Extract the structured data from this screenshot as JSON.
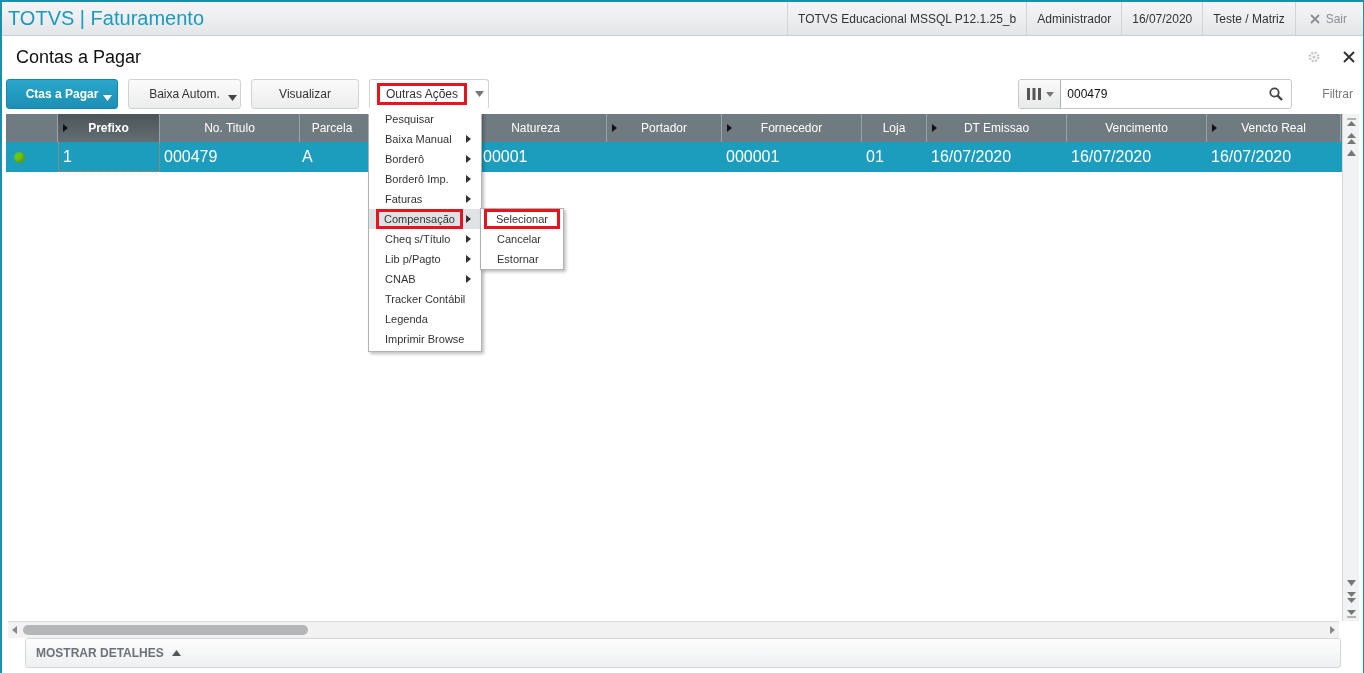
{
  "header": {
    "brand": "TOTVS | Faturamento",
    "items": [
      "TOTVS Educacional MSSQL P12.1.25_b",
      "Administrador",
      "16/07/2020",
      "Teste / Matriz"
    ],
    "exit": "Sair"
  },
  "page": {
    "title": "Contas a Pagar"
  },
  "toolbar": {
    "buttons": [
      {
        "label": "Ctas a Pagar",
        "kind": "primary",
        "dropdown": true,
        "highlighted": false
      },
      {
        "label": "Baixa Autom.",
        "kind": "plain",
        "dropdown": true,
        "highlighted": false
      },
      {
        "label": "Visualizar",
        "kind": "plain",
        "dropdown": false,
        "highlighted": false
      },
      {
        "label": "Outras Ações",
        "kind": "menu",
        "dropdown": true,
        "highlighted": true
      }
    ]
  },
  "search": {
    "value": "000479",
    "filter": "Filtrar"
  },
  "table": {
    "columns": [
      {
        "label": "Prefixo",
        "marker": true,
        "selected": true
      },
      {
        "label": "No. Titulo",
        "marker": false,
        "selected": false
      },
      {
        "label": "Parcela",
        "marker": false,
        "selected": false
      },
      {
        "label": "Natureza",
        "selected": false
      },
      {
        "label": "Portador",
        "marker": true,
        "selected": false
      },
      {
        "label": "Fornecedor",
        "marker": true,
        "selected": false
      },
      {
        "label": "Loja",
        "marker": false,
        "selected": false
      },
      {
        "label": "DT Emissao",
        "marker": true,
        "selected": false
      },
      {
        "label": "Vencimento",
        "marker": false,
        "selected": false
      },
      {
        "label": "Vencto Real",
        "marker": true,
        "selected": false
      }
    ],
    "rows": [
      {
        "selected": true,
        "color": "#6cc417",
        "cells": [
          "1",
          "000479",
          "A",
          "00001",
          "",
          "000001",
          "01",
          "16/07/2020",
          "16/07/2020",
          "16/07/2020"
        ]
      }
    ]
  },
  "menu": {
    "items": [
      {
        "label": "Pesquisar",
        "submenu": false,
        "selected": false,
        "highlighted": false
      },
      {
        "label": "Baixa Manual",
        "submenu": true,
        "selected": false,
        "highlighted": false
      },
      {
        "label": "Borderô",
        "submenu": true,
        "selected": false,
        "highlighted": false
      },
      {
        "label": "Borderô Imp.",
        "submenu": true,
        "selected": false,
        "highlighted": false
      },
      {
        "label": "Faturas",
        "submenu": true,
        "selected": false,
        "highlighted": false
      },
      {
        "label": "Compensação",
        "submenu": true,
        "selected": true,
        "highlighted": true,
        "children": [
          {
            "label": "Selecionar",
            "highlighted": true
          },
          {
            "label": "Cancelar",
            "highlighted": false
          },
          {
            "label": "Estornar",
            "highlighted": false
          }
        ]
      },
      {
        "label": "Cheq s/Título",
        "submenu": true,
        "selected": false,
        "highlighted": false
      },
      {
        "label": "Lib p/Pagto",
        "submenu": true,
        "selected": false,
        "highlighted": false
      },
      {
        "label": "CNAB",
        "submenu": true,
        "selected": false,
        "highlighted": false
      },
      {
        "label": "Tracker Contábil",
        "submenu": false,
        "selected": false,
        "highlighted": false
      },
      {
        "label": "Legenda",
        "submenu": false,
        "selected": false,
        "highlighted": false
      },
      {
        "label": "Imprimir Browse",
        "submenu": false,
        "selected": false,
        "highlighted": false
      }
    ]
  },
  "details": {
    "label": "MOSTRAR DETALHES"
  }
}
